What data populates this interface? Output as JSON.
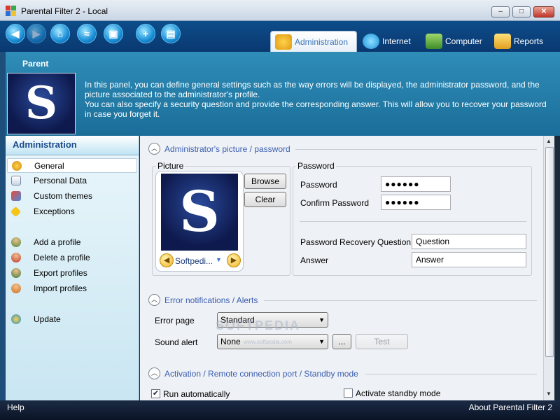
{
  "window": {
    "title": "Parental Filter 2 - Local",
    "minimize_label": "–",
    "maximize_label": "□",
    "close_label": "✕"
  },
  "toolbar": {
    "buttons": [
      {
        "icon": "back-arrow-icon",
        "glyph": "◀"
      },
      {
        "icon": "forward-arrow-icon",
        "glyph": "▶"
      },
      {
        "icon": "home-icon",
        "glyph": "⌂"
      },
      {
        "icon": "chart-icon",
        "glyph": "≈"
      },
      {
        "icon": "save-dropdown-icon",
        "glyph": "▣"
      },
      {
        "icon": "add-icon",
        "glyph": "+"
      },
      {
        "icon": "save-icon",
        "glyph": "▤"
      }
    ],
    "tabs": [
      {
        "label": "Administration",
        "icon": "gears-icon",
        "active": true
      },
      {
        "label": "Internet",
        "icon": "globe-icon",
        "active": false
      },
      {
        "label": "Computer",
        "icon": "computer-icon",
        "active": false
      },
      {
        "label": "Reports",
        "icon": "reports-icon",
        "active": false
      }
    ]
  },
  "header": {
    "parent_label": "Parent",
    "avatar_letter": "S",
    "description_1": "In this panel, you can define general settings such as the way errors will be displayed, the administrator password, and the picture associated to the administrator's profile.",
    "description_2": "You can also specify a security question and provide the corresponding answer. This will allow you to recover your password in case you forget it."
  },
  "sidebar": {
    "title": "Administration",
    "items": [
      {
        "label": "General",
        "icon": "settings-icon",
        "active": true
      },
      {
        "label": "Personal Data",
        "icon": "notepad-icon"
      },
      {
        "label": "Custom themes",
        "icon": "themes-icon"
      },
      {
        "label": "Exceptions",
        "icon": "warning-icon"
      },
      {
        "label": "Add a profile",
        "icon": "add-user-icon"
      },
      {
        "label": "Delete a profile",
        "icon": "delete-user-icon"
      },
      {
        "label": "Export profiles",
        "icon": "export-user-icon"
      },
      {
        "label": "Import profiles",
        "icon": "import-user-icon"
      },
      {
        "label": "Update",
        "icon": "update-icon"
      }
    ]
  },
  "main": {
    "section_picture": "Administrator's picture / password",
    "picture_group_label": "Picture",
    "picture_letter": "S",
    "picture_name": "Softpedi...",
    "browse_label": "Browse",
    "clear_label": "Clear",
    "password_group_label": "Password",
    "password_label": "Password",
    "password_value": "●●●●●●",
    "confirm_password_label": "Confirm Password",
    "confirm_password_value": "●●●●●●",
    "recovery_question_label": "Password Recovery Question",
    "recovery_question_value": "Question",
    "answer_label": "Answer",
    "answer_value": "Answer",
    "section_errors": "Error notifications / Alerts",
    "error_page_label": "Error page",
    "error_page_value": "Standard",
    "sound_alert_label": "Sound alert",
    "sound_alert_value": "None",
    "browse_sound_label": "...",
    "test_label": "Test",
    "section_activation": "Activation / Remote connection port / Standby mode",
    "run_auto_label": "Run automatically",
    "run_auto_checked": true,
    "standby_label": "Activate standby mode",
    "standby_checked": false,
    "watermark": "SOFTPEDIA",
    "watermark_url": "www.softpedia.com"
  },
  "statusbar": {
    "help_label": "Help",
    "about_label": "About Parental Filter 2"
  }
}
